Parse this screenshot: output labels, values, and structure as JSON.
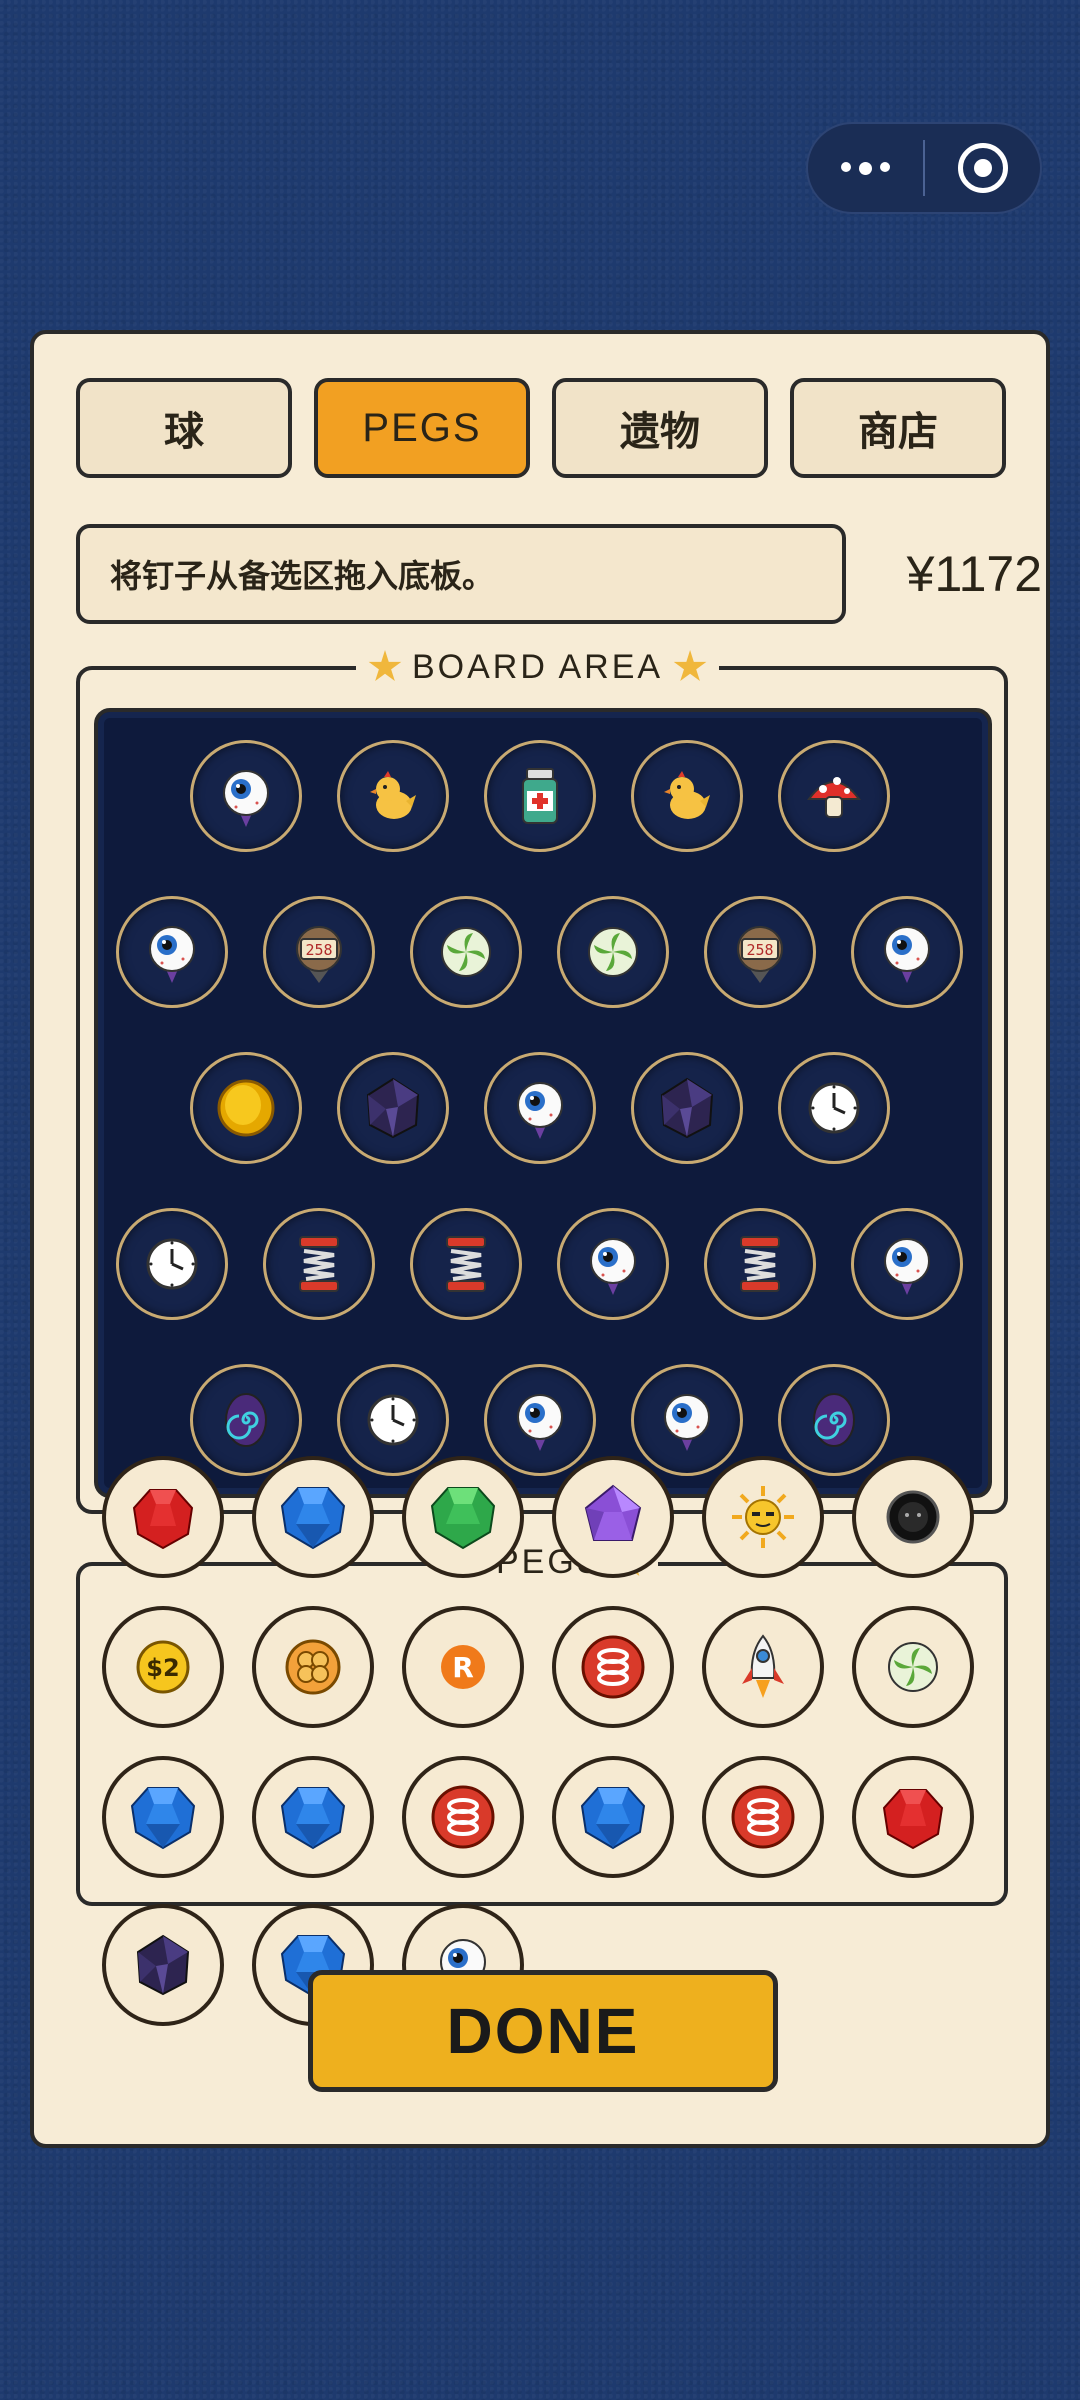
{
  "tabs": [
    {
      "label": "球"
    },
    {
      "label": "PEGS"
    },
    {
      "label": "遗物"
    },
    {
      "label": "商店"
    }
  ],
  "active_tab": 1,
  "message": "将钉子从备选区拖入底板。",
  "money": "¥1172",
  "board_title": "BOARD AREA",
  "pegs_title": "PEGS",
  "done_label": "DONE",
  "counter_text": "258",
  "coin_text": "$2",
  "letter_text": "R",
  "board_rows": [
    [
      "eyeball",
      "chick",
      "medicine",
      "chick",
      "mushroom"
    ],
    [
      "eyeball",
      "counter",
      "swirl",
      "swirl",
      "counter",
      "eyeball"
    ],
    [
      "gold-coin",
      "dark-crystal",
      "eyeball",
      "dark-crystal",
      "clock"
    ],
    [
      "clock",
      "spring",
      "spring",
      "eyeball",
      "spring",
      "eyeball"
    ],
    [
      "portal",
      "clock",
      "eyeball",
      "eyeball",
      "portal"
    ]
  ],
  "tray_rows": [
    [
      "red-gem",
      "blue-gem",
      "green-gem",
      "purple-crystal",
      "sun",
      "black-ball"
    ],
    [
      "dollar-coin",
      "clover",
      "letter-r",
      "spring-coil",
      "rocket",
      "swirl"
    ],
    [
      "blue-gem",
      "blue-gem",
      "spring-coil",
      "blue-gem",
      "spring-coil",
      "red-gem"
    ],
    [
      "dark-crystal",
      "blue-gem",
      "eyeball"
    ]
  ],
  "colors": {
    "background": "#1e3a6e",
    "panel": "#f7ecd6",
    "active_tab": "#f2a022",
    "board": "#0e1a3c",
    "done_button": "#eeb01e"
  }
}
